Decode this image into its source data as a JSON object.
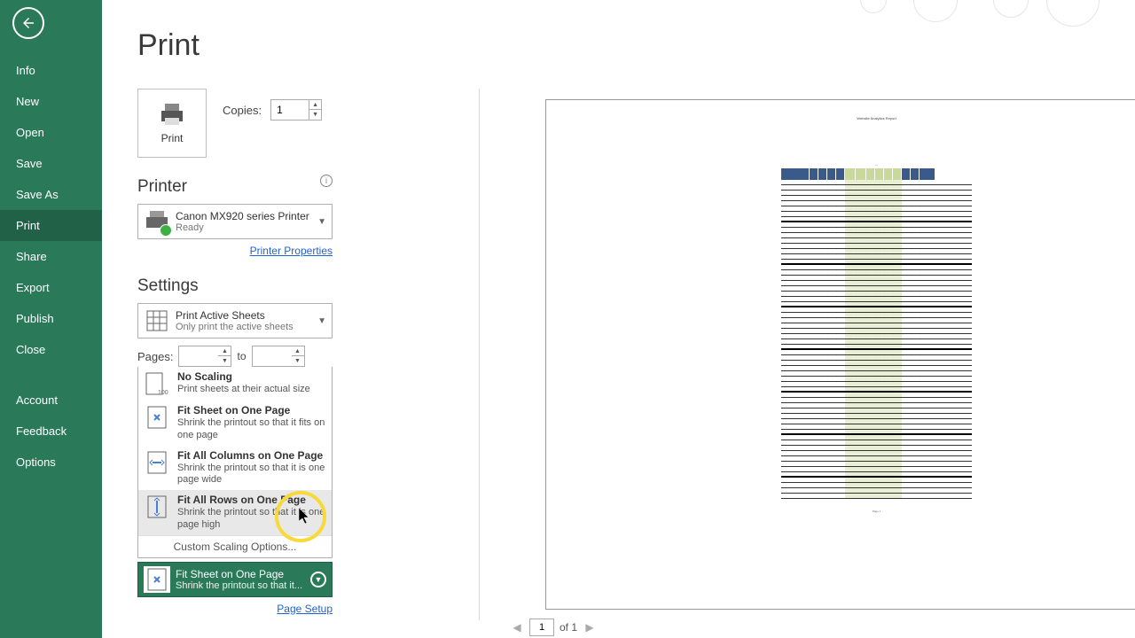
{
  "sidebar": {
    "items": [
      {
        "label": "Info"
      },
      {
        "label": "New"
      },
      {
        "label": "Open"
      },
      {
        "label": "Save"
      },
      {
        "label": "Save As"
      },
      {
        "label": "Print"
      },
      {
        "label": "Share"
      },
      {
        "label": "Export"
      },
      {
        "label": "Publish"
      },
      {
        "label": "Close"
      }
    ],
    "bottom": [
      {
        "label": "Account"
      },
      {
        "label": "Feedback"
      },
      {
        "label": "Options"
      }
    ]
  },
  "page_title": "Print",
  "print_button": "Print",
  "copies": {
    "label": "Copies:",
    "value": "1"
  },
  "printer": {
    "header": "Printer",
    "name": "Canon MX920 series Printer",
    "status": "Ready",
    "properties_link": "Printer Properties"
  },
  "settings": {
    "header": "Settings",
    "active_sheets": {
      "title": "Print Active Sheets",
      "sub": "Only print the active sheets"
    },
    "pages": {
      "label": "Pages:",
      "to": "to"
    },
    "scaling": [
      {
        "title": "No Scaling",
        "desc": "Print sheets at their actual size"
      },
      {
        "title": "Fit Sheet on One Page",
        "desc": "Shrink the printout so that it fits on one page"
      },
      {
        "title": "Fit All Columns on One Page",
        "desc": "Shrink the printout so that it is one page wide"
      },
      {
        "title": "Fit All Rows on One Page",
        "desc": "Shrink the printout so that it is one page high"
      }
    ],
    "custom_scaling": "Custom Scaling Options...",
    "current_scaling": {
      "title": "Fit Sheet on One Page",
      "sub": "Shrink the printout so that it..."
    },
    "page_setup_link": "Page Setup"
  },
  "pager": {
    "page": "1",
    "of": "of 1"
  },
  "preview": {
    "doc_title": "Website Analytics Report"
  }
}
